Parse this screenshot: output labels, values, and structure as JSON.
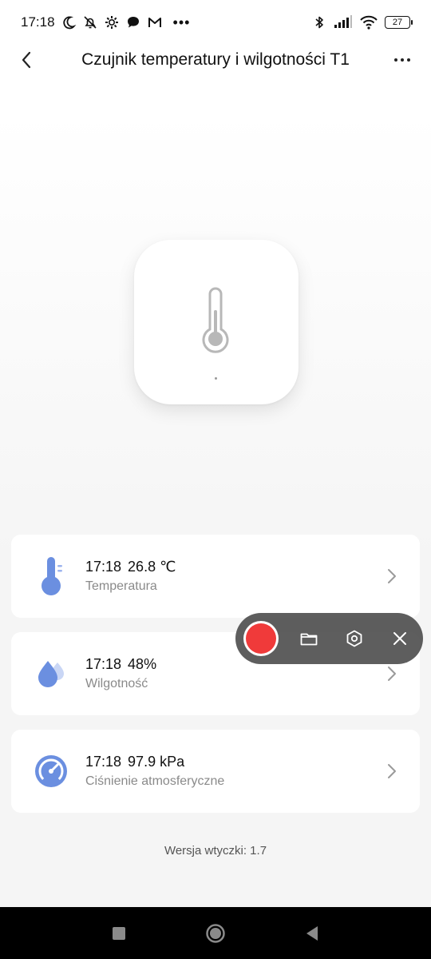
{
  "status_bar": {
    "time": "17:18",
    "battery": "27",
    "left_icons": [
      "moon-icon",
      "muted-bell-icon",
      "gear-icon",
      "chat-icon",
      "gmail-icon"
    ],
    "right_icons": [
      "bluetooth-icon",
      "signal-icon",
      "wifi-icon"
    ]
  },
  "header": {
    "title": "Czujnik temperatury i wilgotności T1"
  },
  "sensors": [
    {
      "time": "17:18",
      "value": "26.8 ℃",
      "label": "Temperatura",
      "icon": "thermometer-icon",
      "color": "#6b8fe0"
    },
    {
      "time": "17:18",
      "value": "48%",
      "label": "Wilgotność",
      "icon": "water-drops-icon",
      "color": "#6b8fe0"
    },
    {
      "time": "17:18",
      "value": "97.9 kPa",
      "label": "Ciśnienie atmosferyczne",
      "icon": "pressure-gauge-icon",
      "color": "#6b8fe0"
    }
  ],
  "footer": {
    "version": "Wersja wtyczki: 1.7"
  },
  "colors": {
    "accent": "#6b8fe0",
    "record": "#f03a3a",
    "recorder_bg": "#484848"
  }
}
